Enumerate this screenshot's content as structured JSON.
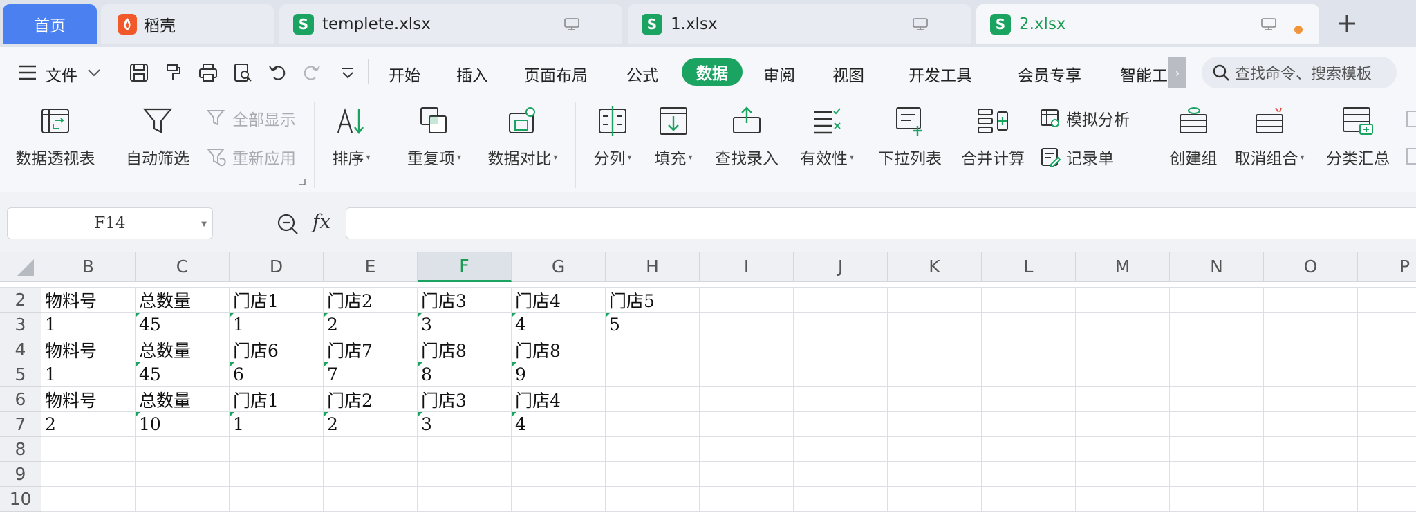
{
  "tabs": [
    {
      "label": "首页",
      "kind": "home"
    },
    {
      "label": "稻壳",
      "kind": "docer"
    },
    {
      "label": "templete.xlsx",
      "kind": "file"
    },
    {
      "label": "1.xlsx",
      "kind": "file"
    },
    {
      "label": "2.xlsx",
      "kind": "file",
      "active": true
    }
  ],
  "file_icon_glyph": "S",
  "menu": {
    "file_label": "文件",
    "items": [
      "开始",
      "插入",
      "页面布局",
      "公式",
      "数据",
      "审阅",
      "视图",
      "开发工具",
      "会员专享",
      "智能工"
    ],
    "active": "数据",
    "scroll_glyph": "›",
    "search_placeholder": "查找命令、搜索模板"
  },
  "ribbon": {
    "pivot": "数据透视表",
    "autofilter": "自动筛选",
    "show_all": "全部显示",
    "reapply": "重新应用",
    "sort": "排序",
    "duplicates": "重复项",
    "compare": "数据对比",
    "split": "分列",
    "fill": "填充",
    "find_entry": "查找录入",
    "validity": "有效性",
    "dropdown_list": "下拉列表",
    "consolidate": "合并计算",
    "what_if": "模拟分析",
    "record_form": "记录单",
    "group": "创建组",
    "ungroup": "取消组合",
    "subtotal": "分类汇总"
  },
  "formula_bar": {
    "cell_ref": "F14",
    "fx_label": "fx",
    "value": ""
  },
  "sheet": {
    "selected_column": "F",
    "columns": [
      "B",
      "C",
      "D",
      "E",
      "F",
      "G",
      "H",
      "I",
      "J",
      "K",
      "L",
      "M",
      "N",
      "O",
      "P"
    ],
    "rows": [
      {
        "num": "2",
        "cells": [
          "物料号",
          "总数量",
          "门店1",
          "门店2",
          "门店3",
          "门店4",
          "门店5"
        ]
      },
      {
        "num": "3",
        "cells": [
          "1",
          "45",
          "1",
          "2",
          "3",
          "4",
          "5"
        ]
      },
      {
        "num": "4",
        "cells": [
          "物料号",
          "总数量",
          "门店6",
          "门店7",
          "门店8",
          "门店8",
          ""
        ]
      },
      {
        "num": "5",
        "cells": [
          "1",
          "45",
          "6",
          "7",
          "8",
          "9",
          ""
        ]
      },
      {
        "num": "6",
        "cells": [
          "物料号",
          "总数量",
          "门店1",
          "门店2",
          "门店3",
          "门店4",
          ""
        ]
      },
      {
        "num": "7",
        "cells": [
          "2",
          "10",
          "1",
          "2",
          "3",
          "4",
          ""
        ]
      },
      {
        "num": "8",
        "cells": []
      },
      {
        "num": "9",
        "cells": []
      },
      {
        "num": "10",
        "cells": []
      }
    ]
  }
}
